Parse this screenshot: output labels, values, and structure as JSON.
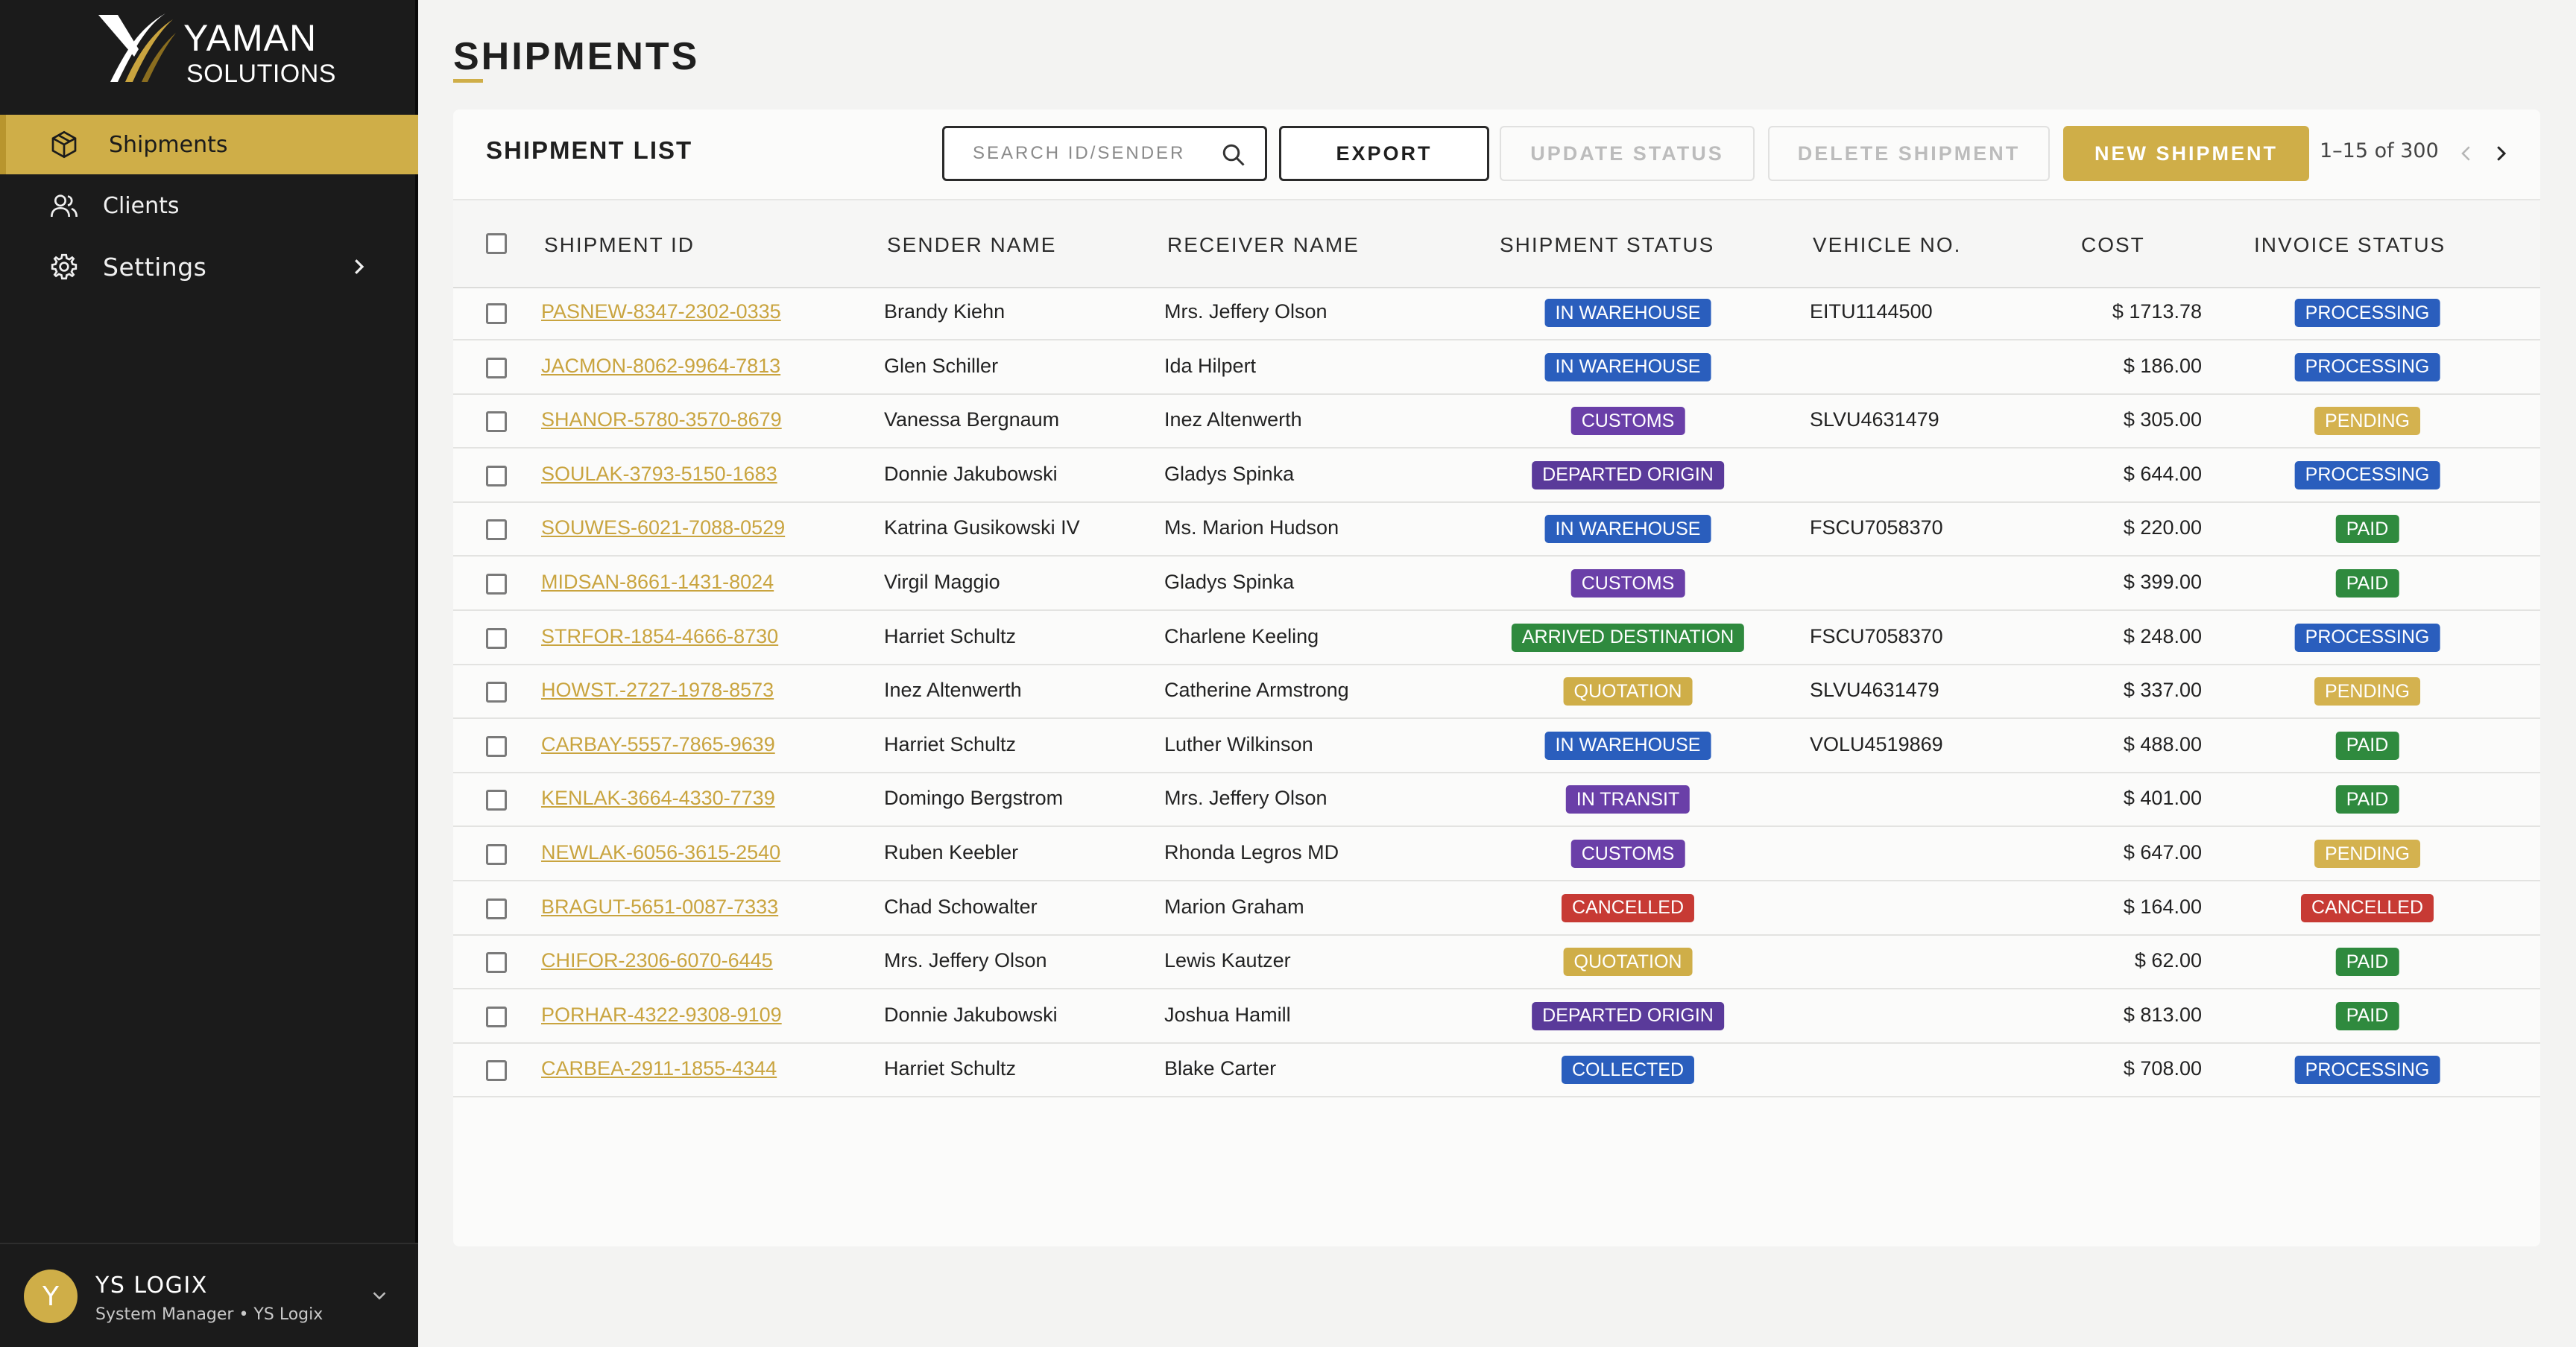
{
  "brand": {
    "line1": "YAMAN",
    "line2": "SOLUTIONS"
  },
  "sidebar": {
    "items": [
      {
        "label": "Shipments",
        "icon": "package-icon",
        "active": true
      },
      {
        "label": "Clients",
        "icon": "users-icon",
        "active": false
      },
      {
        "label": "Settings",
        "icon": "gear-icon",
        "active": false
      }
    ]
  },
  "user": {
    "initial": "Y",
    "name": "YS LOGIX",
    "role": "System Manager • YS Logix"
  },
  "page": {
    "title": "SHIPMENTS"
  },
  "toolbar": {
    "list_title": "SHIPMENT LIST",
    "search_placeholder": "SEARCH ID/SENDER",
    "export_label": "EXPORT",
    "update_label": "UPDATE STATUS",
    "delete_label": "DELETE SHIPMENT",
    "new_label": "NEW SHIPMENT",
    "pagination": "1–15 of 300"
  },
  "table": {
    "columns": [
      "SHIPMENT ID",
      "SENDER NAME",
      "RECEIVER NAME",
      "SHIPMENT STATUS",
      "VEHICLE NO.",
      "COST",
      "INVOICE STATUS"
    ],
    "status_colors": {
      "IN WAREHOUSE": "#2a5ebd",
      "CUSTOMS": "#6a3fa8",
      "DEPARTED ORIGIN": "#5a3a9a",
      "ARRIVED DESTINATION": "#2f8a3e",
      "QUOTATION": "#cfae48",
      "IN TRANSIT": "#6a3fa8",
      "CANCELLED": "#c73a34",
      "COLLECTED": "#2a5ebd",
      "PROCESSING": "#2a5ebd",
      "PENDING": "#d4b24f",
      "PAID": "#2f8a3e"
    },
    "rows": [
      {
        "id": "PASNEW-8347-2302-0335",
        "sender": "Brandy Kiehn",
        "receiver": "Mrs. Jeffery Olson",
        "status": "IN WAREHOUSE",
        "vehicle": "EITU1144500",
        "cost": "$ 1713.78",
        "invoice": "PROCESSING"
      },
      {
        "id": "JACMON-8062-9964-7813",
        "sender": "Glen Schiller",
        "receiver": "Ida Hilpert",
        "status": "IN WAREHOUSE",
        "vehicle": "",
        "cost": "$ 186.00",
        "invoice": "PROCESSING"
      },
      {
        "id": "SHANOR-5780-3570-8679",
        "sender": "Vanessa Bergnaum",
        "receiver": "Inez Altenwerth",
        "status": "CUSTOMS",
        "vehicle": "SLVU4631479",
        "cost": "$ 305.00",
        "invoice": "PENDING"
      },
      {
        "id": "SOULAK-3793-5150-1683",
        "sender": "Donnie Jakubowski",
        "receiver": "Gladys Spinka",
        "status": "DEPARTED ORIGIN",
        "vehicle": "",
        "cost": "$ 644.00",
        "invoice": "PROCESSING"
      },
      {
        "id": "SOUWES-6021-7088-0529",
        "sender": "Katrina Gusikowski IV",
        "receiver": "Ms. Marion Hudson",
        "status": "IN WAREHOUSE",
        "vehicle": "FSCU7058370",
        "cost": "$ 220.00",
        "invoice": "PAID"
      },
      {
        "id": "MIDSAN-8661-1431-8024",
        "sender": "Virgil Maggio",
        "receiver": "Gladys Spinka",
        "status": "CUSTOMS",
        "vehicle": "",
        "cost": "$ 399.00",
        "invoice": "PAID"
      },
      {
        "id": "STRFOR-1854-4666-8730",
        "sender": "Harriet Schultz",
        "receiver": "Charlene Keeling",
        "status": "ARRIVED DESTINATION",
        "vehicle": "FSCU7058370",
        "cost": "$ 248.00",
        "invoice": "PROCESSING"
      },
      {
        "id": "HOWST.-2727-1978-8573",
        "sender": "Inez Altenwerth",
        "receiver": "Catherine Armstrong",
        "status": "QUOTATION",
        "vehicle": "SLVU4631479",
        "cost": "$ 337.00",
        "invoice": "PENDING"
      },
      {
        "id": "CARBAY-5557-7865-9639",
        "sender": "Harriet Schultz",
        "receiver": "Luther Wilkinson",
        "status": "IN WAREHOUSE",
        "vehicle": "VOLU4519869",
        "cost": "$ 488.00",
        "invoice": "PAID"
      },
      {
        "id": "KENLAK-3664-4330-7739",
        "sender": "Domingo Bergstrom",
        "receiver": "Mrs. Jeffery Olson",
        "status": "IN TRANSIT",
        "vehicle": "",
        "cost": "$ 401.00",
        "invoice": "PAID"
      },
      {
        "id": "NEWLAK-6056-3615-2540",
        "sender": "Ruben Keebler",
        "receiver": "Rhonda Legros MD",
        "status": "CUSTOMS",
        "vehicle": "",
        "cost": "$ 647.00",
        "invoice": "PENDING"
      },
      {
        "id": "BRAGUT-5651-0087-7333",
        "sender": "Chad Schowalter",
        "receiver": "Marion Graham",
        "status": "CANCELLED",
        "vehicle": "",
        "cost": "$ 164.00",
        "invoice": "CANCELLED"
      },
      {
        "id": "CHIFOR-2306-6070-6445",
        "sender": "Mrs. Jeffery Olson",
        "receiver": "Lewis Kautzer",
        "status": "QUOTATION",
        "vehicle": "",
        "cost": "$ 62.00",
        "invoice": "PAID"
      },
      {
        "id": "PORHAR-4322-9308-9109",
        "sender": "Donnie Jakubowski",
        "receiver": "Joshua Hamill",
        "status": "DEPARTED ORIGIN",
        "vehicle": "",
        "cost": "$ 813.00",
        "invoice": "PAID"
      },
      {
        "id": "CARBEA-2911-1855-4344",
        "sender": "Harriet Schultz",
        "receiver": "Blake Carter",
        "status": "COLLECTED",
        "vehicle": "",
        "cost": "$ 708.00",
        "invoice": "PROCESSING"
      }
    ]
  }
}
